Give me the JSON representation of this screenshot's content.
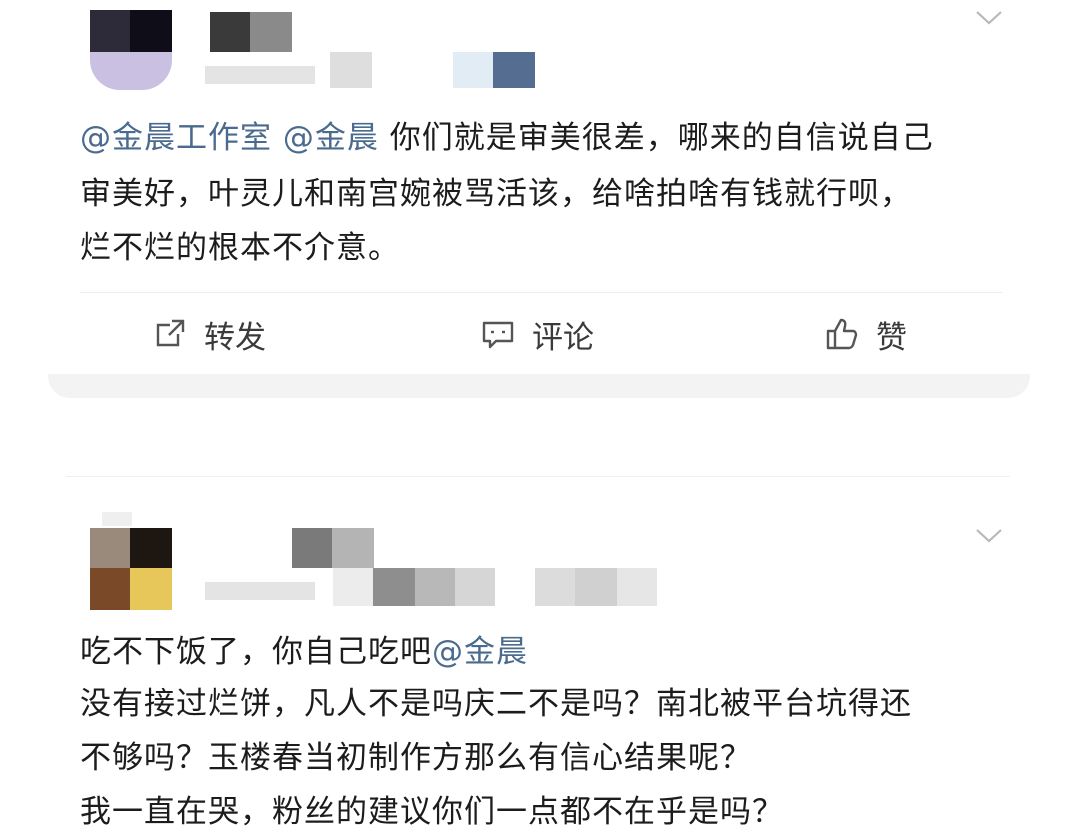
{
  "post1": {
    "segments": [
      {
        "text": "@金晨工作室",
        "mention": true
      },
      {
        "text": " ",
        "mention": false
      },
      {
        "text": "@金晨",
        "mention": true
      },
      {
        "text": " 你们就是审美很差，哪来的自信说自己",
        "mention": false
      }
    ],
    "line2": "审美好，叶灵儿和南宫婉被骂活该，给啥拍啥有钱就行呗，",
    "line3": "烂不烂的根本不介意。"
  },
  "actions": {
    "repost": "转发",
    "comment": "评论",
    "like": "赞"
  },
  "post2": {
    "line1_text": "吃不下饭了，你自己吃吧",
    "line1_mention": "@金晨",
    "line2": "没有接过烂饼，凡人不是吗庆二不是吗？南北被平台坑得还",
    "line3": "不够吗？玉楼春当初制作方那么有信心结果呢？",
    "line4": "我一直在哭，粉丝的建议你们一点都不在乎是吗？"
  },
  "colors": {
    "mention": "#4a6a8e",
    "text": "#1c1c1c",
    "separator": "#f2f2f2"
  },
  "icons": [
    "chevron-down-icon",
    "repost-icon",
    "comment-icon",
    "like-icon"
  ]
}
